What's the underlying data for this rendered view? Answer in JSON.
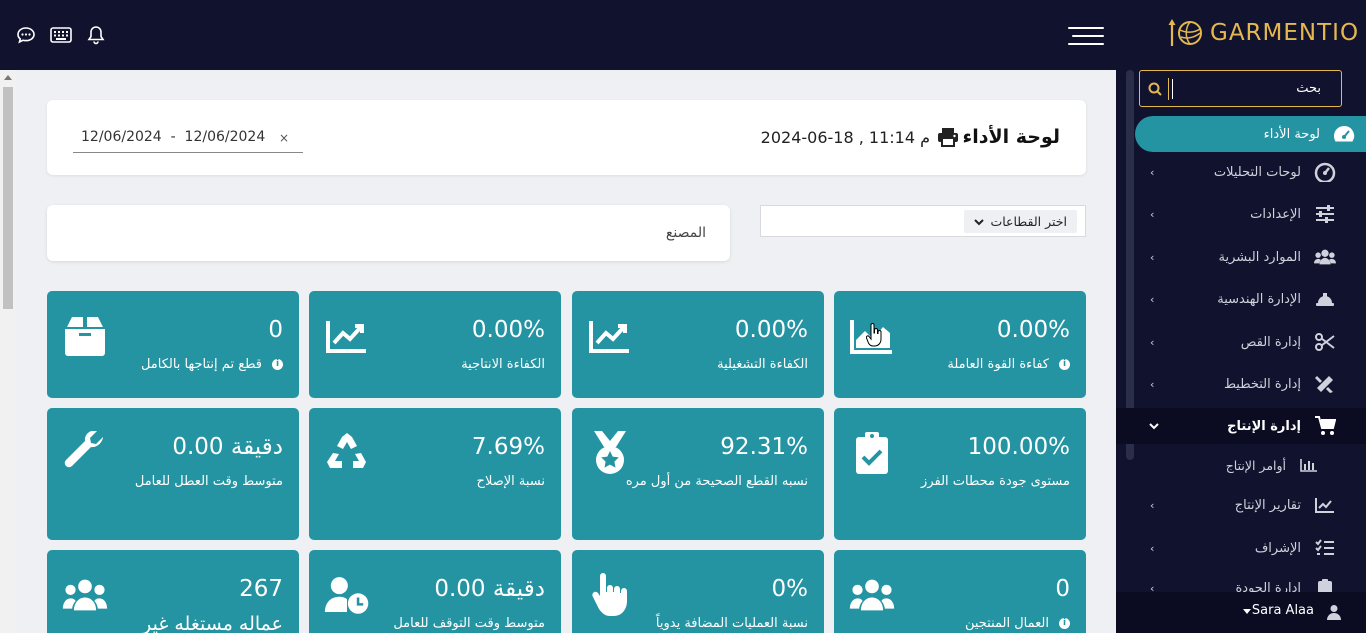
{
  "app": {
    "brand": "GARMENTIO",
    "accent": "#2494a2",
    "dark": "#11132e",
    "gold": "#e4b84d"
  },
  "topbar": {
    "icons": [
      "chat-icon",
      "keyboard-icon",
      "bell-icon",
      "hamburger-icon"
    ]
  },
  "sidebar": {
    "search_placeholder": "بحث",
    "items": [
      {
        "label": "لوحة الأداء",
        "icon": "dashboard-icon",
        "active": true
      },
      {
        "label": "لوحات التحليلات",
        "icon": "gauge-icon"
      },
      {
        "label": "الإعدادات",
        "icon": "sliders-icon"
      },
      {
        "label": "الموارد البشرية",
        "icon": "users-icon"
      },
      {
        "label": "الإدارة الهندسية",
        "icon": "hard-hat-icon"
      },
      {
        "label": "إدارة القص",
        "icon": "scissors-icon"
      },
      {
        "label": "إدارة التخطيط",
        "icon": "ruler-pencil-icon"
      },
      {
        "label": "إدارة الإنتاج",
        "icon": "cart-icon",
        "expanded": true
      },
      {
        "label": "تقارير الإنتاج",
        "icon": "chart-line-icon"
      },
      {
        "label": "الإشراف",
        "icon": "checklist-icon"
      },
      {
        "label": "إدارة الجودة",
        "icon": "clipboard-icon"
      }
    ],
    "sub_items": [
      {
        "label": "أوامر الإنتاج",
        "icon": "bar-chart-icon"
      }
    ],
    "user": "Sara Alaa"
  },
  "header": {
    "title": "لوحة الأداء",
    "datetime": "2024-06-18 , 11:14 م",
    "date_range": "12/06/2024  -  12/06/2024",
    "clear": "×"
  },
  "filters": {
    "factory_label": "المصنع",
    "sector_select": "اختر القطاعات"
  },
  "cards": [
    {
      "value": "0.00%",
      "label": "كفاءة القوة العاملة",
      "info": true,
      "icon": "chart-area-icon"
    },
    {
      "value": "0.00%",
      "label": "الكفاءة التشغيلية",
      "icon": "chart-line-icon"
    },
    {
      "value": "0.00%",
      "label": "الكفاءة الانتاجية",
      "icon": "chart-line-icon"
    },
    {
      "value": "0",
      "label": "قطع تم إنتاجها بالكامل",
      "info": true,
      "icon": "box-icon"
    },
    {
      "value": "100.00%",
      "label": "مستوى جودة محطات الفرز",
      "icon": "clipboard-check-icon"
    },
    {
      "value": "92.31%",
      "label": "نسبه القطع الصحيحة من أول مره",
      "icon": "medal-icon"
    },
    {
      "value": "7.69%",
      "label": "نسبة الإصلاح",
      "icon": "recycle-icon"
    },
    {
      "value": "0.00 دقيقة",
      "label": "متوسط وقت العطل للعامل",
      "icon": "wrench-icon"
    },
    {
      "value": "0",
      "label": "العمال المنتجين",
      "info": true,
      "icon": "users-icon"
    },
    {
      "value": "0%",
      "label": "نسبة العمليات المضافة يدوياً",
      "icon": "hand-pointer-icon"
    },
    {
      "value": "0.00 دقيقة",
      "label": "متوسط وقت التوقف للعامل",
      "icon": "user-clock-icon"
    },
    {
      "value": "267",
      "label": "عماله مستغله غير",
      "icon": "users-icon"
    }
  ]
}
